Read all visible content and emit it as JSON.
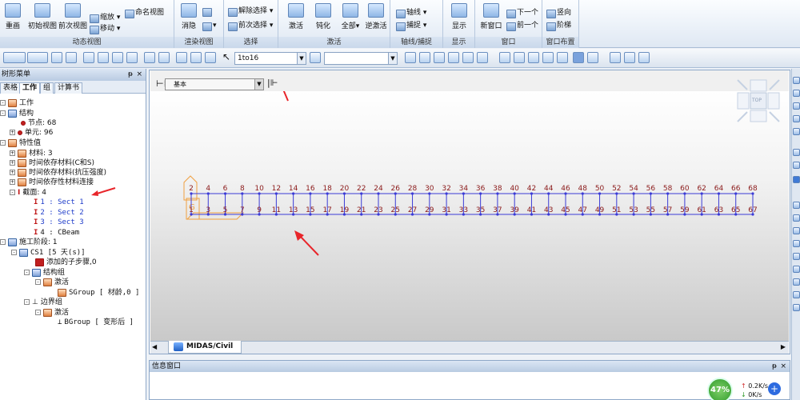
{
  "ribbon": {
    "groups": [
      {
        "title": "动态视图",
        "big": [
          "重画",
          "初始视图",
          "前次视图"
        ],
        "small": [
          "缩放",
          "移动"
        ],
        "extra": "命名视图"
      },
      {
        "title": "渲染视图",
        "big": [
          "消隐"
        ]
      },
      {
        "title": "选择",
        "small": [
          "解除选择",
          "前次选择"
        ]
      },
      {
        "title": "激活",
        "big": [
          "激活",
          "钝化",
          "全部",
          "逆激活"
        ]
      },
      {
        "title": "轴线/捕捉",
        "small": [
          "轴线",
          "捕捉"
        ]
      },
      {
        "title": "显示",
        "big": [
          "显示"
        ]
      },
      {
        "title": "窗口",
        "big": [
          "新窗口"
        ],
        "small": [
          "下一个",
          "前一个"
        ]
      },
      {
        "title": "窗口布置",
        "small": [
          "竖向",
          "阶梯"
        ]
      }
    ]
  },
  "toolbar": {
    "selection_value": "1to16",
    "filter_value": ""
  },
  "tree": {
    "title": "树形菜单",
    "pin": "ᵽ",
    "close": "×",
    "tabs": [
      "表格",
      "工作",
      "组",
      "计算书"
    ],
    "active_tab": "工作",
    "nodes": {
      "root": "工作",
      "structure": "结构",
      "nodes_count": "节点: 68",
      "elements_count": "单元: 96",
      "properties": "特性值",
      "material": "材料: 3",
      "td_material_cs": "时间依存材料(C和S)",
      "td_material_strength": "时间依存材料(抗压强度)",
      "td_material_link": "时间依存性材料连接",
      "section": "截面: 4",
      "sect1": "1 : Sect 1",
      "sect2": "2 : Sect 2",
      "sect3": "3 : Sect 3",
      "sect4": "4 : CBeam",
      "stages": "施工阶段: 1",
      "cs1": "CS1 [5 天(s)]",
      "substeps": "添加的子步骤,0",
      "struct_group": "结构组",
      "activate1": "激活",
      "sgroup": "SGroup [ 材龄,0 ]",
      "boundary_group": "边界组",
      "activate2": "激活",
      "bgroup": "BGroup [ 变形后 ]"
    }
  },
  "view": {
    "combo_value": "基本",
    "tab_label": "MIDAS/Civil",
    "cube_label": "TOP",
    "top_labels": [
      "2",
      "4",
      "6",
      "8",
      "10",
      "12",
      "14",
      "16",
      "18",
      "20",
      "22",
      "24",
      "26",
      "28",
      "30",
      "32",
      "34",
      "36",
      "38",
      "40",
      "42",
      "44",
      "46",
      "48",
      "50",
      "52",
      "54",
      "56",
      "58",
      "60",
      "62",
      "64",
      "66",
      "68"
    ],
    "bottom_labels": [
      "1",
      "3",
      "5",
      "7",
      "9",
      "11",
      "13",
      "15",
      "17",
      "19",
      "21",
      "23",
      "25",
      "27",
      "29",
      "31",
      "33",
      "35",
      "37",
      "39",
      "41",
      "43",
      "45",
      "47",
      "49",
      "51",
      "53",
      "55",
      "57",
      "59",
      "61",
      "63",
      "65",
      "67"
    ],
    "support_label": "G"
  },
  "info": {
    "title": "信息窗口",
    "pin": "ᵽ",
    "close": "×"
  },
  "net": {
    "percent": "47%",
    "up": "0.2K/s",
    "down": "0K/s",
    "plus": "+"
  },
  "colors": {
    "node_label": "#8b1a1a",
    "element_line": "#3b3bd6",
    "arrow": "#e8252a",
    "support": "#f0a040"
  }
}
